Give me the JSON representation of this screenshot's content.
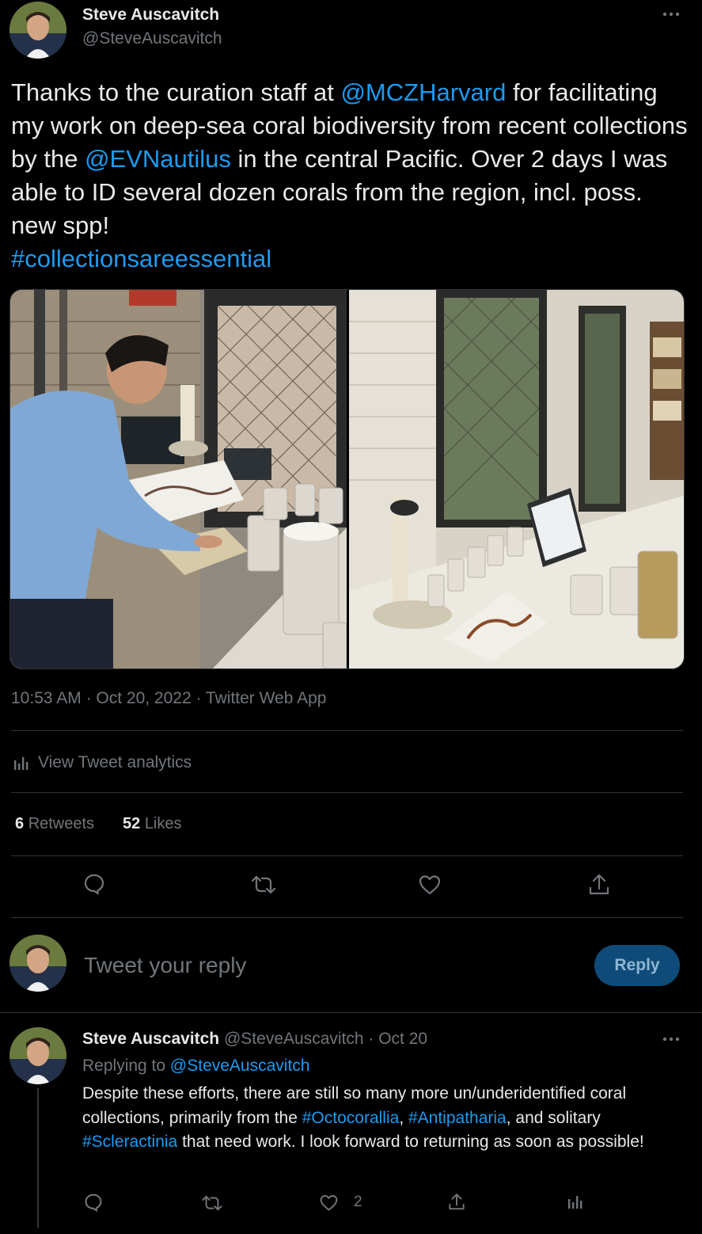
{
  "tweet": {
    "author_name": "Steve Auscavitch",
    "author_handle": "@SteveAuscavitch",
    "text_segments": [
      {
        "text": "Thanks to the curation staff at ",
        "type": "text"
      },
      {
        "text": "@MCZHarvard",
        "type": "link"
      },
      {
        "text": " for facilitating my work on deep-sea coral biodiversity from recent collections by the ",
        "type": "text"
      },
      {
        "text": "@EVNautilus",
        "type": "link"
      },
      {
        "text": " in the central Pacific. Over 2 days I was able to ID several dozen corals from the region, incl. poss. new spp!",
        "type": "text"
      },
      {
        "text": "#collectionsareessential",
        "type": "link"
      }
    ],
    "meta": "10:53 AM · Oct 20, 2022 · Twitter Web App",
    "analytics_label": "View Tweet analytics",
    "retweets_count": "6",
    "retweets_label": "Retweets",
    "likes_count": "52",
    "likes_label": "Likes"
  },
  "reply_box": {
    "placeholder": "Tweet your reply",
    "button_label": "Reply"
  },
  "reply_tweet": {
    "author_name": "Steve Auscavitch",
    "author_handle": "@SteveAuscavitch",
    "date": "Oct 20",
    "replying_prefix": "Replying to ",
    "replying_to": "@SteveAuscavitch",
    "text_segments": [
      {
        "text": "Despite these efforts, there are still so many more un/underidentified coral collections, primarily from the ",
        "type": "text"
      },
      {
        "text": "#Octocorallia",
        "type": "link"
      },
      {
        "text": ", ",
        "type": "text"
      },
      {
        "text": "#Antipatharia",
        "type": "link"
      },
      {
        "text": ", and solitary ",
        "type": "text"
      },
      {
        "text": "#Scleractinia",
        "type": "link"
      },
      {
        "text": " that need work. I look forward to returning as soon as possible!",
        "type": "text"
      }
    ],
    "likes_count": "2"
  },
  "icons": {
    "more": "more-horizontal-icon",
    "analytics": "bar-chart-icon",
    "reply": "reply-bubble-icon",
    "retweet": "retweet-icon",
    "like": "heart-icon",
    "share": "share-icon"
  },
  "colors": {
    "background": "#000000",
    "text": "#e7e9ea",
    "muted": "#71767b",
    "link": "#1d9bf0",
    "divider": "#2f3336",
    "reply_button_bg": "#0e4b78"
  }
}
